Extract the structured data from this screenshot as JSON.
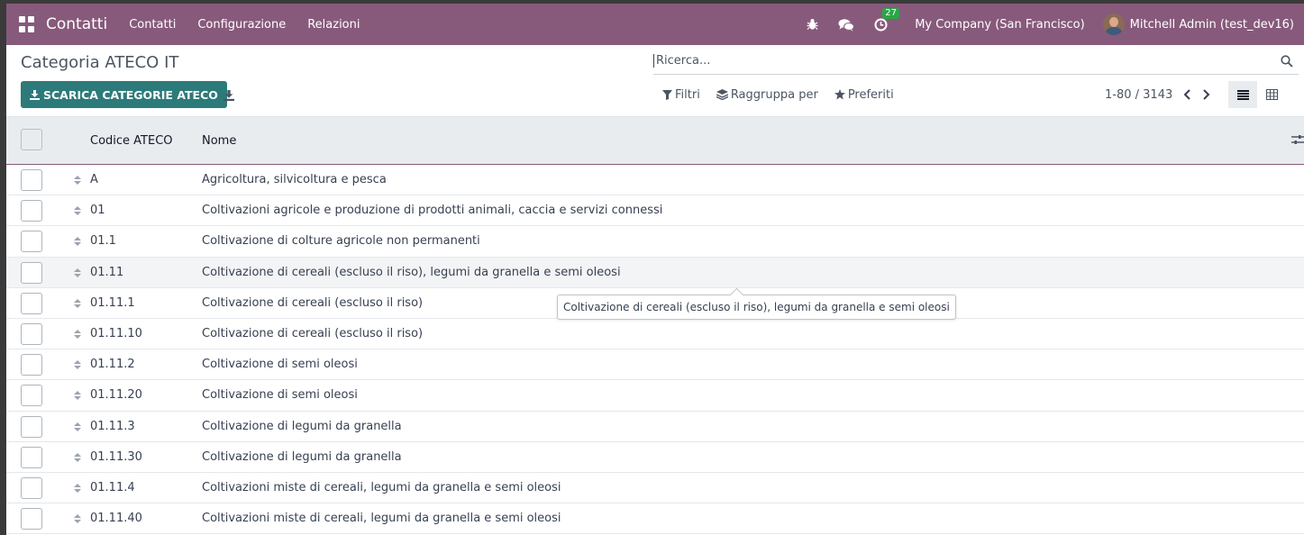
{
  "navbar": {
    "app_name": "Contatti",
    "menu": [
      "Contatti",
      "Configurazione",
      "Relazioni"
    ],
    "activity_count": "27",
    "company": "My Company (San Francisco)",
    "user": "Mitchell Admin (test_dev16)",
    "icons": [
      "apps-icon",
      "bug-icon",
      "chat-icon",
      "clock-icon",
      "user-avatar"
    ],
    "color": "#875a7b"
  },
  "control_panel": {
    "title": "Categoria ATECO IT",
    "primary_button": "SCARICA CATEGORIE ATECO",
    "primary_color": "#2d7a7a",
    "search_placeholder": "Ricerca...",
    "filters": "Filtri",
    "group_by": "Raggruppa per",
    "favorites": "Preferiti",
    "pager": "1-80 / 3143",
    "views": [
      "list-view",
      "pivot-view"
    ],
    "active_view": "list-view"
  },
  "table": {
    "columns": [
      "Codice ATECO",
      "Nome"
    ],
    "rows": [
      {
        "code": "A",
        "name": "Agricoltura, silvicoltura e pesca"
      },
      {
        "code": "01",
        "name": "Coltivazioni agricole e produzione di prodotti animali, caccia e servizi connessi"
      },
      {
        "code": "01.1",
        "name": "Coltivazione di colture agricole non permanenti"
      },
      {
        "code": "01.11",
        "name": "Coltivazione di cereali (escluso il riso), legumi da granella e semi oleosi"
      },
      {
        "code": "01.11.1",
        "name": "Coltivazione di cereali (escluso il riso)"
      },
      {
        "code": "01.11.10",
        "name": "Coltivazione di cereali (escluso il riso)"
      },
      {
        "code": "01.11.2",
        "name": "Coltivazione di semi oleosi"
      },
      {
        "code": "01.11.20",
        "name": "Coltivazione di semi oleosi"
      },
      {
        "code": "01.11.3",
        "name": "Coltivazione di legumi da granella"
      },
      {
        "code": "01.11.30",
        "name": "Coltivazione di legumi da granella"
      },
      {
        "code": "01.11.4",
        "name": "Coltivazioni miste di cereali, legumi da granella e semi oleosi"
      },
      {
        "code": "01.11.40",
        "name": "Coltivazioni miste di cereali, legumi da granella e semi oleosi"
      }
    ]
  },
  "tooltip": {
    "text": "Coltivazione di cereali (escluso il riso), legumi da granella e semi oleosi"
  }
}
